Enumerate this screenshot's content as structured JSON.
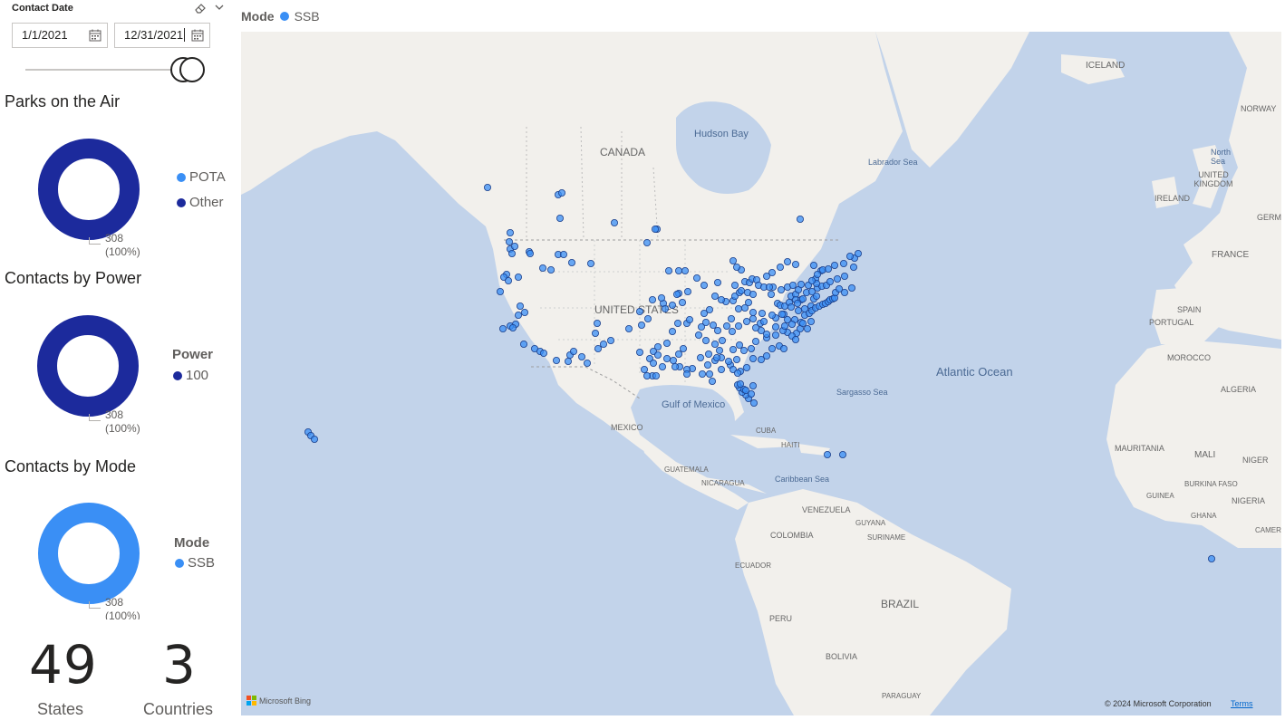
{
  "slicer": {
    "title": "Contact Date",
    "start_date": "1/1/2021",
    "end_date": "12/31/2021",
    "icons": [
      "eraser-icon",
      "chevron-down-icon",
      "calendar-icon"
    ]
  },
  "parks": {
    "title": "Parks on the Air",
    "legend": [
      {
        "label": "POTA",
        "color": "#3a8ff5"
      },
      {
        "label": "Other",
        "color": "#1c2a9c"
      }
    ],
    "value": "308",
    "percent": "(100%)"
  },
  "power": {
    "title": "Contacts by Power",
    "legend_title": "Power",
    "legend": [
      {
        "label": "100",
        "color": "#1c2a9c"
      }
    ],
    "value": "308",
    "percent": "(100%)"
  },
  "mode": {
    "title": "Contacts by Mode",
    "legend_title": "Mode",
    "legend": [
      {
        "label": "SSB",
        "color": "#3a8ff5"
      }
    ],
    "value": "308",
    "percent": "(100%)"
  },
  "cards": [
    {
      "value": "49",
      "label": "States"
    },
    {
      "value": "3",
      "label": "Countries"
    }
  ],
  "map": {
    "legend_title": "Mode",
    "legend_item": "SSB",
    "legend_color": "#3a8ff5",
    "labels": {
      "canada": "CANADA",
      "united_states": "UNITED STATES",
      "hudson_bay": "Hudson Bay",
      "labrador_sea": "Labrador Sea",
      "iceland": "ICELAND",
      "norway": "NORWAY",
      "north_sea": "North Sea",
      "united_kingdom": "UNITED KINGDOM",
      "ireland": "IRELAND",
      "germany": "GERMAN",
      "france": "FRANCE",
      "spain": "SPAIN",
      "portugal": "PORTUGAL",
      "morocco": "MOROCCO",
      "algeria": "ALGERIA",
      "mauritania": "MAURITANIA",
      "mali": "MALI",
      "niger": "NIGER",
      "burkina_faso": "BURKINA FASO",
      "nigeria": "NIGERIA",
      "guinea": "GUINEA",
      "ghana": "GHANA",
      "cameroon": "CAMER",
      "atlantic": "Atlantic Ocean",
      "sargasso": "Sargasso Sea",
      "gulf_mexico": "Gulf of Mexico",
      "mexico": "MEXICO",
      "cuba": "CUBA",
      "haiti": "HAITI",
      "caribbean": "Caribbean Sea",
      "guatemala": "GUATEMALA",
      "nicaragua": "NICARAGUA",
      "venezuela": "VENEZUELA",
      "guyana": "GUYANA",
      "suriname": "SURINAME",
      "colombia": "COLOMBIA",
      "ecuador": "ECUADOR",
      "peru": "PERU",
      "brazil": "BRAZIL",
      "bolivia": "BOLIVIA",
      "paraguay": "PARAGUAY"
    },
    "bing_logo": "Microsoft Bing",
    "copyright": "© 2024 Microsoft Corporation",
    "terms": "Terms"
  }
}
